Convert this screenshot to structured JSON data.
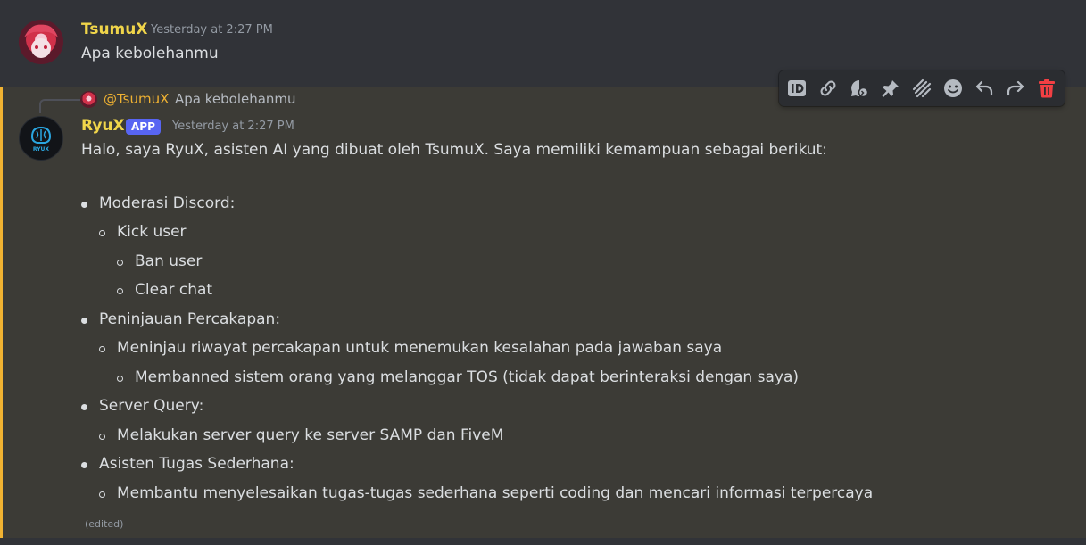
{
  "message1": {
    "username": "TsumuX",
    "timestamp": "Yesterday at 2:27 PM",
    "content": "Apa kebolehanmu",
    "username_color": "#f0d54a"
  },
  "message2": {
    "reply": {
      "user": "@TsumuX",
      "text": "Apa kebolehanmu"
    },
    "username": "RyuX",
    "badge": "APP",
    "timestamp": "Yesterday at 2:27 PM",
    "intro": "Halo, saya RyuX, asisten AI yang dibuat oleh TsumuX. Saya memiliki kemampuan sebagai berikut:",
    "items": [
      {
        "label": "Moderasi Discord:",
        "sub": [
          "Kick user"
        ],
        "subsub": [
          "Ban user",
          "Clear chat"
        ]
      },
      {
        "label": "Peninjauan Percakapan:",
        "sub": [
          "Meninjau riwayat percakapan untuk menemukan kesalahan pada jawaban saya"
        ],
        "subsub": [
          "Membanned sistem orang yang melanggar TOS (tidak dapat berinteraksi dengan saya)"
        ]
      },
      {
        "label": "Server Query:",
        "sub": [
          "Melakukan server query ke server SAMP dan FiveM"
        ],
        "subsub": []
      },
      {
        "label": "Asisten Tugas Sederhana:",
        "sub": [
          "Membantu menyelesaikan tugas-tugas sederhana seperti coding dan mencari informasi terpercaya"
        ],
        "subsub": []
      }
    ],
    "edited": "(edited)",
    "username_color": "#f0d54a",
    "highlight_color": "#f0b232",
    "avatar_text": "RYUX"
  },
  "toolbar": {
    "icons": [
      "id-icon",
      "link-icon",
      "thread-icon",
      "pin-icon",
      "apps-icon",
      "emoji-icon",
      "reply-icon",
      "forward-icon",
      "delete-icon"
    ],
    "delete_color": "#f23f43"
  }
}
